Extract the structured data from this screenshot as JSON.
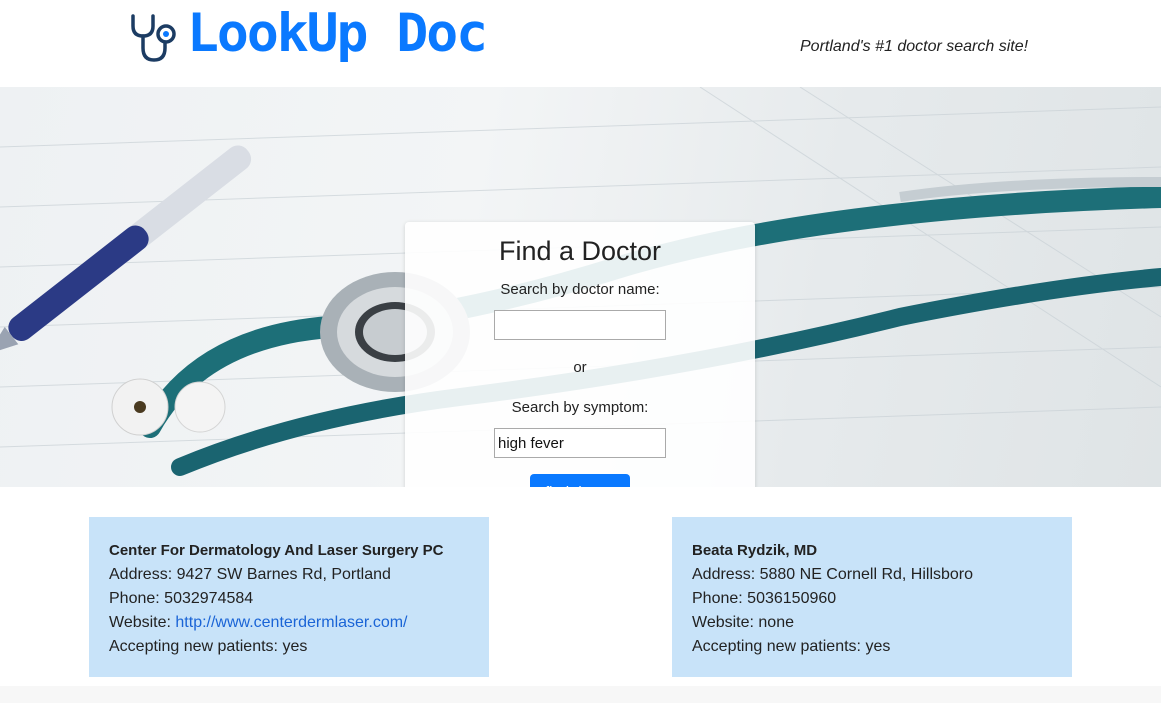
{
  "header": {
    "logo_text": "LookUp Doc",
    "logo_icon": "stethoscope-icon",
    "tagline": "Portland's #1 doctor search site!",
    "brand_color": "#0a79ff"
  },
  "search": {
    "title": "Find a Doctor",
    "name_label": "Search by doctor name:",
    "name_value": "",
    "or_text": "or",
    "symptom_label": "Search by symptom:",
    "symptom_value": "high fever",
    "button_label": "find doctor"
  },
  "results": [
    {
      "name": "Center For Dermatology And Laser Surgery PC",
      "address_label": "Address:",
      "address": "9427 SW Barnes Rd, Portland",
      "phone_label": "Phone:",
      "phone": "5032974584",
      "website_label": "Website:",
      "website": "http://www.centerdermlaser.com/",
      "accepting_label": "Accepting new patients:",
      "accepting": "yes"
    },
    {
      "name": "Beata Rydzik, MD",
      "address_label": "Address:",
      "address": "5880 NE Cornell Rd, Hillsboro",
      "phone_label": "Phone:",
      "phone": "5036150960",
      "website_label": "Website:",
      "website": "none",
      "accepting_label": "Accepting new patients:",
      "accepting": "yes"
    }
  ],
  "colors": {
    "card_bg": "#c8e3f9",
    "link": "#1a64d6",
    "button": "#0a79ff"
  }
}
